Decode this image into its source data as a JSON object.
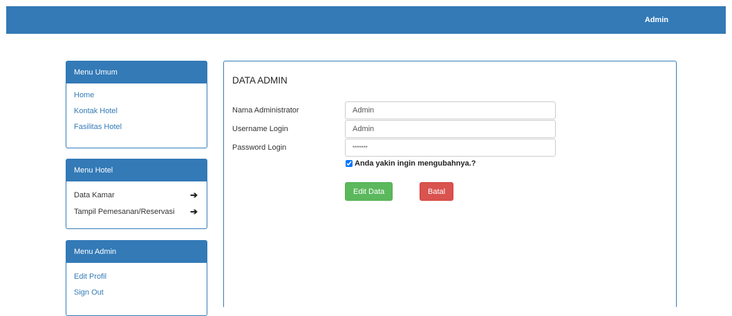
{
  "topbar": {
    "user_label": "Admin"
  },
  "menu_umum": {
    "title": "Menu Umum",
    "items": [
      "Home",
      "Kontak Hotel",
      "Fasilitas Hotel"
    ]
  },
  "menu_hotel": {
    "title": "Menu Hotel",
    "items": [
      "Data Kamar",
      "Tampil Pemesanan/Reservasi"
    ]
  },
  "menu_admin": {
    "title": "Menu Admin",
    "items": [
      "Edit Profil",
      "Sign Out"
    ]
  },
  "form": {
    "title": "DATA ADMIN",
    "name_label": "Nama Administrator",
    "name_value": "Admin",
    "username_label": "Username Login",
    "username_value": "Admin",
    "password_label": "Password Login",
    "password_value": "*******",
    "confirm_label": "Anda yakin ingin mengubahnya.?",
    "confirm_checked": true,
    "edit_button": "Edit Data",
    "cancel_button": "Batal"
  },
  "colors": {
    "primary": "#337ab7",
    "success": "#5cb85c",
    "danger": "#d9534f"
  },
  "icons": {
    "menu_arrow": "arrow-right-icon"
  }
}
